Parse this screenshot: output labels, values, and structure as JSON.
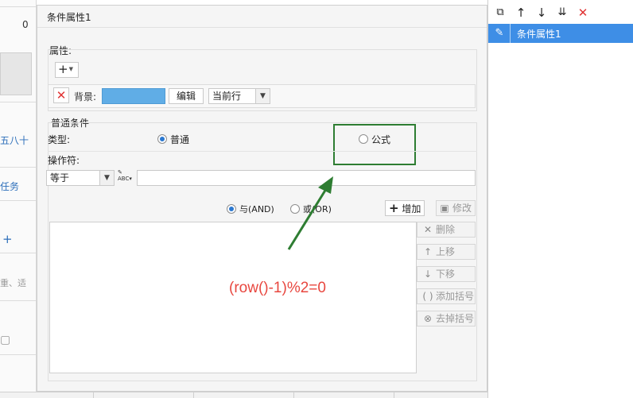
{
  "background": {
    "fragments": [
      "0",
      "五八十",
      "任务",
      "+",
      "重、适"
    ]
  },
  "dialog": {
    "title": "条件属性1",
    "attributes": {
      "section_label": "属性:",
      "add_button_label": "+",
      "background_label": "背景:",
      "background_color": "#60ade6",
      "edit_button_label": "编辑",
      "scope_select_value": "当前行"
    },
    "condition": {
      "section_label": "普通条件",
      "type_label": "类型:",
      "type_options": [
        {
          "label": "普通",
          "selected": true
        },
        {
          "label": "公式",
          "selected": false
        }
      ],
      "operator_label": "操作符:",
      "operator_value": "等于",
      "value_text": "",
      "logic_options": [
        {
          "label": "与(AND)",
          "selected": true
        },
        {
          "label": "或(OR)",
          "selected": false
        }
      ],
      "add_button_label": "增加",
      "modify_button_label": "修改",
      "side_buttons": [
        "删除",
        "上移",
        "下移",
        "添加括号",
        "去掉括号"
      ]
    },
    "annotation": {
      "formula_text": "(row()-1)%2=0",
      "highlight_color": "#2e7d32",
      "text_color": "#e8473f"
    }
  },
  "right_panel": {
    "toolbar_icons": [
      "copy-icon",
      "move-up-icon",
      "move-down-icon",
      "move-bottom-icon",
      "delete-icon"
    ],
    "items": [
      {
        "label": "条件属性1",
        "selected": true
      }
    ],
    "selection_color": "#3e8ee6"
  }
}
